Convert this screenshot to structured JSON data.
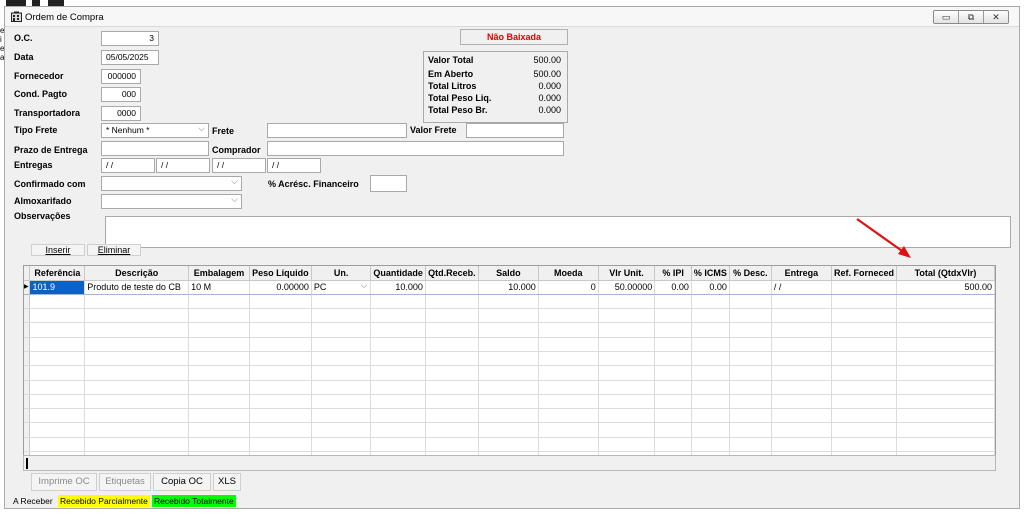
{
  "window": {
    "title": "Ordem de Compra",
    "controls": [
      "▭",
      "⧉",
      "✕"
    ]
  },
  "desk_letters": "e\ni\ne\na",
  "header": {
    "oc_label": "O.C.",
    "oc_value": "3",
    "data_label": "Data",
    "data_value": "05/05/2025",
    "fornecedor_label": "Fornecedor",
    "fornecedor_value": "000000",
    "cond_pagto_label": "Cond. Pagto",
    "cond_pagto_value": "000",
    "transportadora_label": "Transportadora",
    "transportadora_value": "0000",
    "tipo_frete_label": "Tipo Frete",
    "tipo_frete_value": "* Nenhum *",
    "frete_label": "Frete",
    "frete_value": "",
    "valor_frete_label": "Valor Frete",
    "valor_frete_value": "",
    "prazo_label": "Prazo de Entrega",
    "prazo_value": "",
    "comprador_label": "Comprador",
    "comprador_value": "",
    "entregas_label": "Entregas",
    "entregas_values": [
      " /  /",
      " /  /",
      " /  /",
      " /  /"
    ],
    "confirmado_label": "Confirmado com",
    "confirmado_value": "",
    "acresc_label": "% Acrésc. Financeiro",
    "acresc_value": "",
    "almox_label": "Almoxarifado",
    "almox_value": "",
    "obs_label": "Observações",
    "obs_value": ""
  },
  "status": {
    "text": "Não Baixada",
    "color": "#e00000"
  },
  "totals": [
    {
      "label": "Valor Total",
      "value": "500.00"
    },
    {
      "label": "Em Aberto",
      "value": "500.00"
    },
    {
      "label": "Total Litros",
      "value": "0.000"
    },
    {
      "label": "Total Peso Liq.",
      "value": "0.000"
    },
    {
      "label": "Total Peso Br.",
      "value": "0.000"
    }
  ],
  "grid_buttons": {
    "inserir": "Inserir",
    "eliminar": "Eliminar"
  },
  "grid": {
    "columns": [
      "Referência",
      "Descrição",
      "Embalagem",
      "Peso Liquido",
      "Un.",
      "Quantidade",
      "Qtd.Receb.",
      "Saldo",
      "Moeda",
      "Vlr Unit.",
      "% IPI",
      "% ICMS",
      "% Desc.",
      "Entrega",
      "Ref. Forneced",
      "Total (QtdxVlr)"
    ],
    "rows": [
      {
        "ref": "101.9",
        "descricao": "Produto de teste do CB",
        "embalagem": "10 M",
        "peso": "0.00000",
        "un": "PC",
        "quantidade": "10.000",
        "qtd_receb": "",
        "saldo": "10.000",
        "moeda": "0",
        "vlr_unit": "50.00000",
        "ipi": "0.00",
        "icms": "0.00",
        "desc": "",
        "entrega": " /  /",
        "ref_forn": "",
        "total": "500.00"
      }
    ],
    "row_marker": "▶"
  },
  "bottom_buttons": [
    {
      "label": "Imprime OC",
      "enabled": false
    },
    {
      "label": "Etiquetas",
      "enabled": false
    },
    {
      "label": "Copia OC",
      "enabled": true
    },
    {
      "label": "XLS",
      "enabled": true
    }
  ],
  "legend": [
    {
      "label": "A Receber",
      "color": "#f0f0f0"
    },
    {
      "label": "Recebido Parcialmente",
      "color": "#ffff00"
    },
    {
      "label": "Recebido Totalmente",
      "color": "#00ff00"
    }
  ],
  "annotation_arrow_color": "#e01010"
}
